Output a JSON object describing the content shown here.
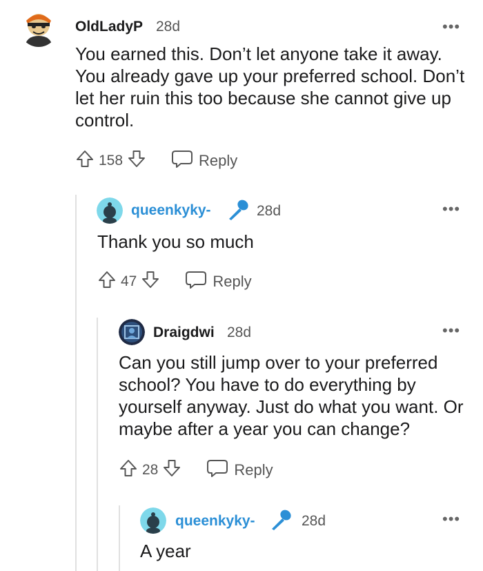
{
  "comments": [
    {
      "username": "OldLadyP",
      "time": "28d",
      "more": "•••",
      "body": "You earned this. Don’t let anyone take it away. You already gave up your preferred school. Don’t let her ruin this too because she cannot give up control.",
      "score": "158",
      "reply_label": "Reply"
    },
    {
      "username": "queenkyky-",
      "time": "28d",
      "more": "•••",
      "body": "Thank you so much",
      "score": "47",
      "reply_label": "Reply"
    },
    {
      "username": "Draigdwi",
      "time": "28d",
      "more": "•••",
      "body": "Can you still jump over to your preferred school? You have to do everything by yourself anyway. Just do what you want. Or maybe after a year you can change?",
      "score": "28",
      "reply_label": "Reply"
    },
    {
      "username": "queenkyky-",
      "time": "28d",
      "more": "•••",
      "body": "A year"
    }
  ],
  "colors": {
    "op_username": "#2b8fd6",
    "thread_line": "#e0e0e0",
    "text": "#1a1a1b",
    "muted": "#555555"
  },
  "icons": {
    "upvote": "arrow-up-icon",
    "downvote": "arrow-down-icon",
    "reply": "speech-bubble-icon",
    "op_badge": "microphone-icon",
    "more": "ellipsis-icon"
  }
}
